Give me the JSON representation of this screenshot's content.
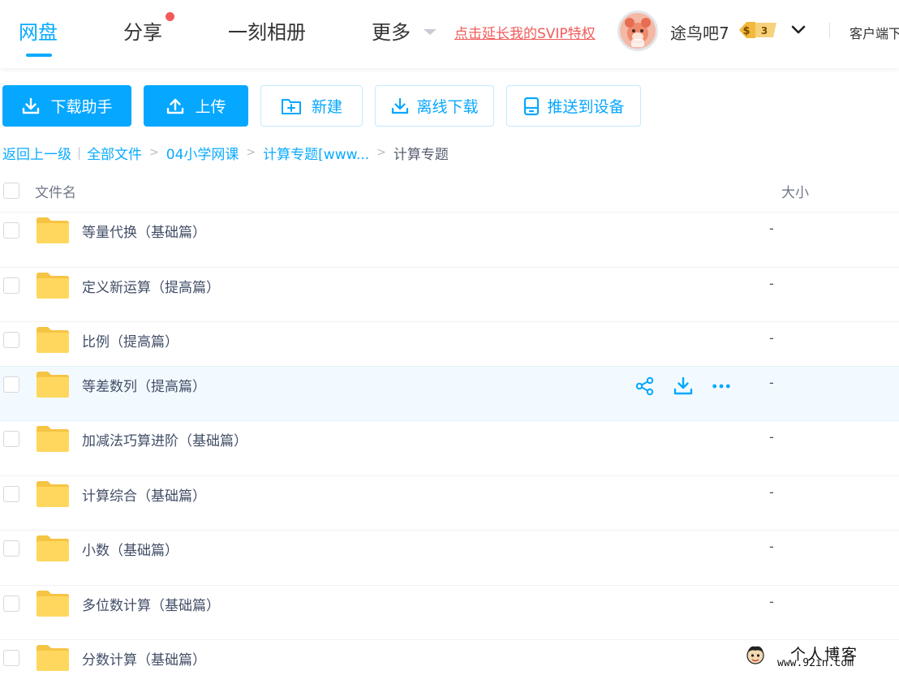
{
  "nav": {
    "tabs": [
      {
        "label": "网盘",
        "active": true
      },
      {
        "label": "分享",
        "active": false
      },
      {
        "label": "一刻相册",
        "active": false
      },
      {
        "label": "更多",
        "active": false
      }
    ],
    "promo": "点击延长我的SVIP特权",
    "username": "途鸟吧7",
    "vip_level": "3",
    "client_label": "客户端下"
  },
  "toolbar": {
    "download_helper": "下载助手",
    "upload": "上传",
    "new": "新建",
    "offline_download": "离线下载",
    "push_to_device": "推送到设备"
  },
  "breadcrumb": {
    "back": "返回上一级",
    "items": [
      "全部文件",
      "04小学网课",
      "计算专题[www..."
    ],
    "current": "计算专题"
  },
  "table": {
    "col_name": "文件名",
    "col_size": "大小",
    "rows": [
      {
        "name": "等量代换（基础篇）",
        "size": "-"
      },
      {
        "name": "定义新运算（提高篇）",
        "size": "-"
      },
      {
        "name": "比例（提高篇）",
        "size": "-"
      },
      {
        "name": "等差数列（提高篇）",
        "size": "-"
      },
      {
        "name": "加减法巧算进阶（基础篇）",
        "size": "-"
      },
      {
        "name": "计算综合（基础篇）",
        "size": "-"
      },
      {
        "name": "小数（基础篇）",
        "size": "-"
      },
      {
        "name": "多位数计算（基础篇）",
        "size": "-"
      },
      {
        "name": "分数计算（基础篇）",
        "size": "-"
      }
    ]
  },
  "watermark": {
    "title": "个人博客",
    "url": "www.92in.com"
  },
  "colors": {
    "accent": "#06a7ff",
    "promo": "#f25a5a",
    "folder": "#ffd454",
    "hover_row": "#f3faff"
  }
}
